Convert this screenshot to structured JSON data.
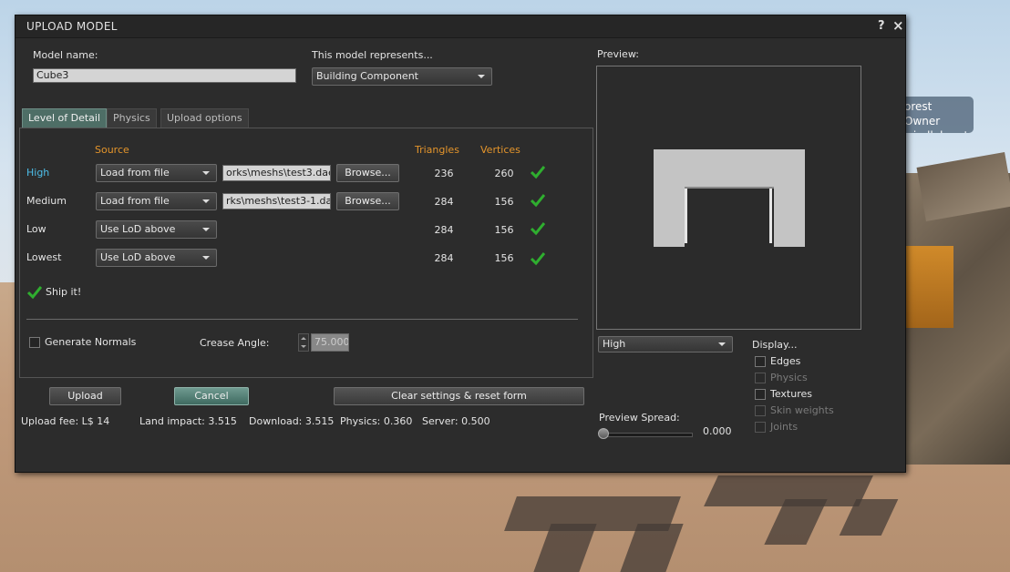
{
  "window": {
    "title": "UPLOAD MODEL",
    "help_glyph": "?",
    "close_glyph": "×"
  },
  "model_name": {
    "label": "Model name:",
    "value": "Cube3"
  },
  "represents": {
    "label": "This model represents...",
    "selected": "Building Component"
  },
  "tabs": [
    {
      "label": "Level of Detail",
      "active": true
    },
    {
      "label": "Physics",
      "active": false
    },
    {
      "label": "Upload options",
      "active": false
    }
  ],
  "lod": {
    "headers": {
      "source": "Source",
      "triangles": "Triangles",
      "vertices": "Vertices"
    },
    "rows": [
      {
        "name": "High",
        "source": "Load from file",
        "file": "orks\\meshs\\test3.dae",
        "browse": "Browse...",
        "triangles": "236",
        "vertices": "260"
      },
      {
        "name": "Medium",
        "source": "Load from file",
        "file": "rks\\meshs\\test3-1.dae",
        "browse": "Browse...",
        "triangles": "284",
        "vertices": "156"
      },
      {
        "name": "Low",
        "source": "Use LoD above",
        "triangles": "284",
        "vertices": "156"
      },
      {
        "name": "Lowest",
        "source": "Use LoD above",
        "triangles": "284",
        "vertices": "156"
      }
    ],
    "ship_it": "Ship it!",
    "generate_normals": "Generate Normals",
    "crease_angle_label": "Crease Angle:",
    "crease_angle_value": "75.000"
  },
  "buttons": {
    "upload": "Upload",
    "cancel": "Cancel",
    "clear": "Clear settings & reset form"
  },
  "fees": {
    "upload_fee": "Upload fee: L$ 14",
    "land_impact": "Land impact: 3.515",
    "download": "Download: 3.515",
    "physics": "Physics: 0.360",
    "server": "Server: 0.500"
  },
  "preview": {
    "label": "Preview:",
    "lod_selected": "High",
    "display_label": "Display...",
    "display_options": [
      {
        "label": "Edges",
        "enabled": true
      },
      {
        "label": "Physics",
        "enabled": false
      },
      {
        "label": "Textures",
        "enabled": true
      },
      {
        "label": "Skin weights",
        "enabled": false
      },
      {
        "label": "Joints",
        "enabled": false
      }
    ],
    "spread_label": "Preview Spread:",
    "spread_value": "0.000",
    "spread_fraction": 0
  },
  "scene": {
    "nametag_line1": "orest Owner",
    "nametag_line2": "windlehurst"
  },
  "colors": {
    "accent_orange": "#e3942b",
    "accent_blue": "#4dbde8",
    "check_green": "#2fae2f",
    "active_tab": "#4e6e66"
  },
  "icons": {
    "check": "check-icon",
    "dropdown": "chevron-down-icon",
    "close": "close-icon",
    "help": "help-icon"
  }
}
